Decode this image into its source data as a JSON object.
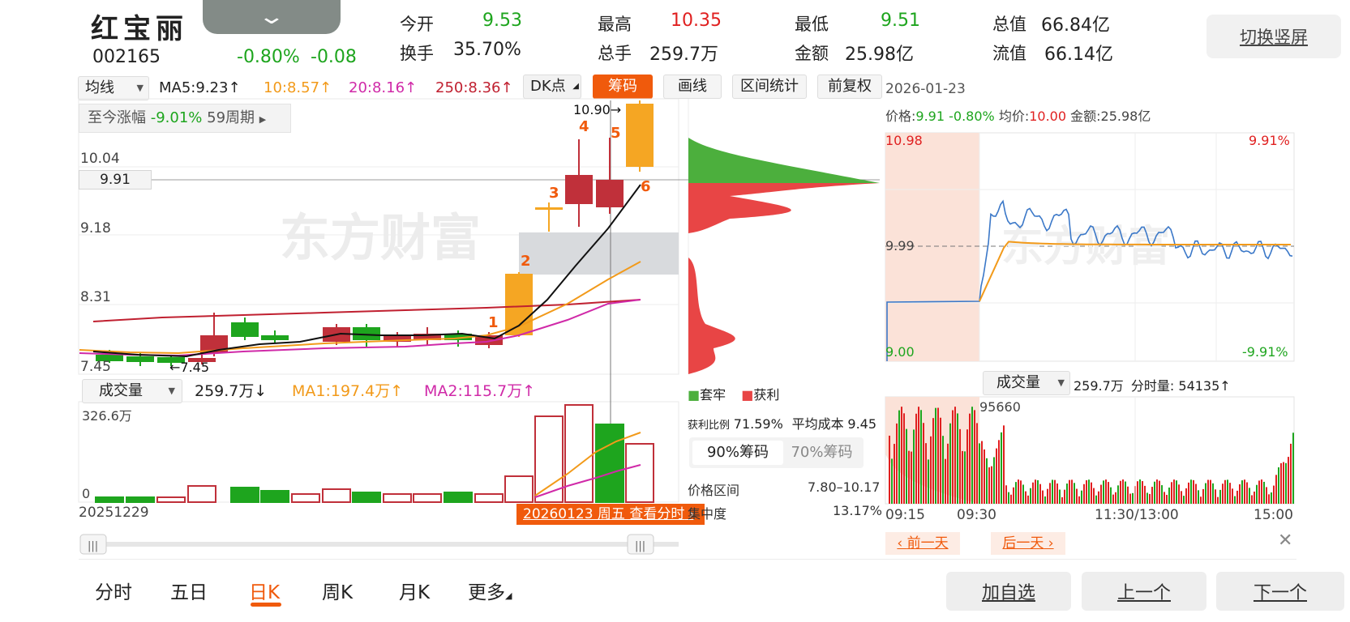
{
  "header": {
    "name": "红宝丽",
    "code": "002165",
    "pct_change": "-0.80%",
    "change": "-0.08",
    "quotes": [
      {
        "label": "今开",
        "value": "9.53",
        "color": "#1ea51e"
      },
      {
        "label": "最高",
        "value": "10.35",
        "color": "#e02020"
      },
      {
        "label": "最低",
        "value": "9.51",
        "color": "#1ea51e"
      },
      {
        "label": "总值",
        "value": "66.84亿",
        "color": "#222222"
      },
      {
        "label": "换手",
        "value": "35.70%",
        "color": "#222222"
      },
      {
        "label": "总手",
        "value": "259.7万",
        "color": "#222222"
      },
      {
        "label": "金额",
        "value": "25.98亿",
        "color": "#222222"
      },
      {
        "label": "流值",
        "value": "66.14亿",
        "color": "#222222"
      }
    ],
    "switch_button": "切换竖屏"
  },
  "kline": {
    "indicator_select": "均线",
    "ma5": "MA5:9.23↑",
    "ma10": "10:8.57↑",
    "ma20": "20:8.16↑",
    "ma250": "250:8.36↑",
    "buttons": [
      "DK点",
      "筹码",
      "画线",
      "区间统计",
      "前复权"
    ],
    "since_label": "至今涨幅",
    "since_value": "-9.01%",
    "since_period": "59周期",
    "price_axis": [
      "10.04",
      "9.18",
      "8.31",
      "7.45"
    ],
    "current_price_tag": "9.91",
    "high_marker": "10.90→",
    "low_marker": "←7.45",
    "dk_labels": [
      "1",
      "2",
      "3",
      "4",
      "5",
      "6"
    ]
  },
  "volume": {
    "indicator_select": "成交量",
    "value": "259.7万↓",
    "ma1": "MA1:197.4万↑",
    "ma2": "MA2:115.7万↑",
    "max_label": "326.6万",
    "zero_label": "0",
    "start_date": "20251229",
    "selected_date": "20260123 周五 查看分时"
  },
  "chip": {
    "legend_trapped": "套牢",
    "legend_profit": "获利",
    "profit_ratio_label": "获利比例",
    "profit_ratio": "71.59%",
    "avg_cost_label": "平均成本",
    "avg_cost": "9.45",
    "tab_90": "90%筹码",
    "tab_70": "70%筹码",
    "range_label": "价格区间",
    "range_value": "7.80–10.17",
    "concentration_label": "集中度",
    "concentration_value": "13.17%"
  },
  "intraday": {
    "date": "2026-01-23",
    "price_label": "价格:",
    "price": "9.91",
    "price_pct": "-0.80%",
    "avg_label": "均价:",
    "avg": "10.00",
    "amount_label": "金额:",
    "amount": "25.98亿",
    "top_left": "10.98",
    "top_right": "9.91%",
    "mid": "9.99",
    "bottom_left": "9.00",
    "bottom_right": "-9.91%",
    "vol_select": "成交量",
    "vol_value": "259.7万",
    "vol_minute": "分时量: 54135↑",
    "vol_max": "95660",
    "times": [
      "09:15",
      "09:30",
      "11:30/13:00",
      "15:00"
    ],
    "prev_day": "前一天",
    "next_day": "后一天"
  },
  "tabs": [
    "分时",
    "五日",
    "日K",
    "周K",
    "月K",
    "更多"
  ],
  "active_tab": "日K",
  "actions": {
    "add": "加自选",
    "prev": "上一个",
    "next": "下一个"
  },
  "watermark": "东方财富"
}
